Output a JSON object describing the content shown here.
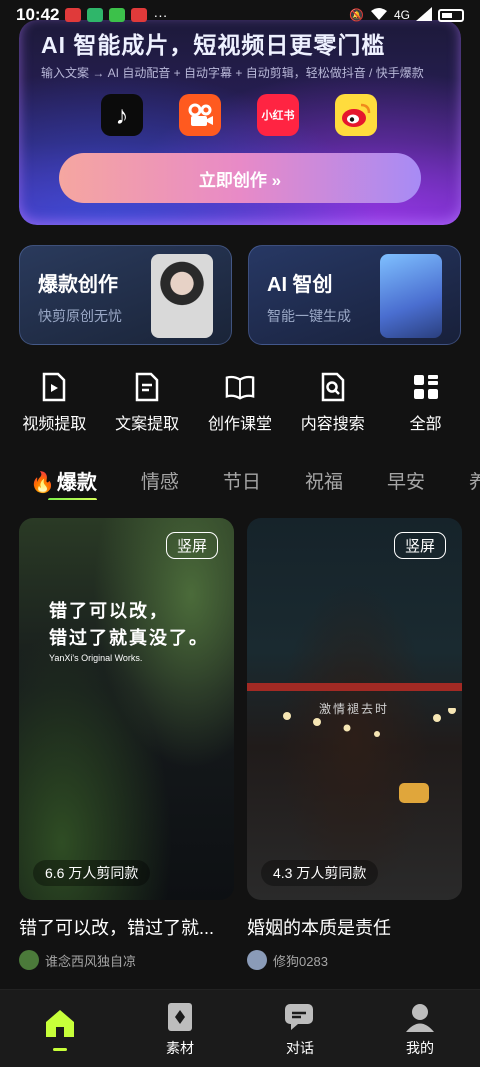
{
  "status_bar": {
    "time": "10:42",
    "network": "4G"
  },
  "banner": {
    "title": "AI 智能成片，短视频日更零门槛",
    "subtitle": "输入文案 → AI 自动配音 + 自动字幕 + 自动剪辑，轻松做抖音 / 快手爆款",
    "platforms": [
      {
        "name": "douyin",
        "label": "♪"
      },
      {
        "name": "kuaishou",
        "label": ""
      },
      {
        "name": "xiaohongshu",
        "label": "小红书"
      },
      {
        "name": "weibo",
        "label": ""
      }
    ],
    "cta": "立即创作 »"
  },
  "features": [
    {
      "title": "爆款创作",
      "subtitle": "快剪原创无忧"
    },
    {
      "title": "AI 智创",
      "subtitle": "智能一键生成"
    }
  ],
  "tools": [
    {
      "label": "视频提取",
      "icon": "video-extract-icon"
    },
    {
      "label": "文案提取",
      "icon": "text-extract-icon"
    },
    {
      "label": "创作课堂",
      "icon": "book-icon"
    },
    {
      "label": "内容搜索",
      "icon": "search-doc-icon"
    },
    {
      "label": "全部",
      "icon": "grid-icon"
    }
  ],
  "tabs": [
    {
      "label": "爆款",
      "active": true
    },
    {
      "label": "情感"
    },
    {
      "label": "节日"
    },
    {
      "label": "祝福"
    },
    {
      "label": "早安"
    },
    {
      "label": "养"
    }
  ],
  "cards": [
    {
      "tag": "竖屏",
      "overlay_line1": "错了可以改，",
      "overlay_line2": "错过了就真没了。",
      "overlay_small": "YanXi's Original Works.",
      "count": "6.6 万人剪同款",
      "title": "错了可以改，错过了就...",
      "author": "谁念西风独自凉"
    },
    {
      "tag": "竖屏",
      "overlay_line1": "激情褪去时",
      "count": "4.3 万人剪同款",
      "title": "婚姻的本质是责任",
      "author": "修狗0283"
    }
  ],
  "nav": [
    {
      "label": "",
      "icon": "home-icon",
      "active": true
    },
    {
      "label": "素材",
      "icon": "material-icon"
    },
    {
      "label": "对话",
      "icon": "chat-icon"
    },
    {
      "label": "我的",
      "icon": "profile-icon"
    }
  ],
  "colors": {
    "accent": "#c7ff3a",
    "background": "#121212"
  }
}
